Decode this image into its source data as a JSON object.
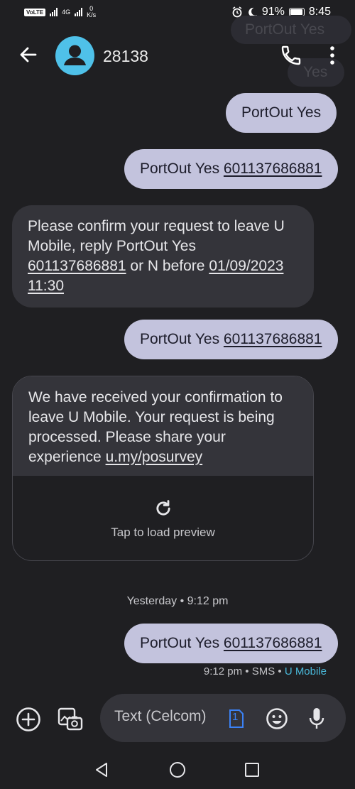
{
  "status_bar": {
    "volte": "VoLTE",
    "net_type": "4G",
    "speed_value": "0",
    "speed_unit": "K/s",
    "battery": "91%",
    "time": "8:45"
  },
  "header": {
    "contact": "28138"
  },
  "ghost_bubbles": [
    "PortOut Yes",
    "Yes"
  ],
  "messages": [
    {
      "dir": "out",
      "text": "PortOut Yes"
    },
    {
      "dir": "out",
      "text": "PortOut Yes ",
      "link": "601137686881"
    },
    {
      "dir": "in",
      "part1": "Please confirm your request to leave U Mobile, reply PortOut Yes ",
      "link1": "601137686881",
      "part2": " or N before ",
      "link2": "01/09/2023 11:30"
    },
    {
      "dir": "out",
      "text": "PortOut Yes ",
      "link": "601137686881"
    },
    {
      "dir": "in",
      "text": "We have received your confirmation to leave U Mobile. Your request is being processed. Please share your experience ",
      "link": "u.my/posurvey",
      "preview_label": "Tap to load preview"
    },
    {
      "dir": "out",
      "text": "PortOut Yes ",
      "link": "601137686881"
    }
  ],
  "date_separator": "Yesterday • 9:12 pm",
  "last_meta": {
    "time": "9:12 pm",
    "sep": " • ",
    "type": "SMS",
    "carrier": "U Mobile"
  },
  "compose": {
    "placeholder": "Text (Celcom)",
    "sim": "1"
  },
  "colors": {
    "background": "#1f1f22",
    "outgoing_bubble": "#c3c3dd",
    "incoming_bubble": "#34343a",
    "accent": "#4fc1e9",
    "carrier_link": "#49b7d8"
  },
  "icons": [
    "back-arrow-icon",
    "person-icon",
    "phone-icon",
    "more-vert-icon",
    "refresh-icon",
    "add-circle-icon",
    "gallery-camera-icon",
    "sim-icon",
    "emoji-icon",
    "mic-icon",
    "nav-back-icon",
    "nav-home-icon",
    "nav-recents-icon"
  ]
}
